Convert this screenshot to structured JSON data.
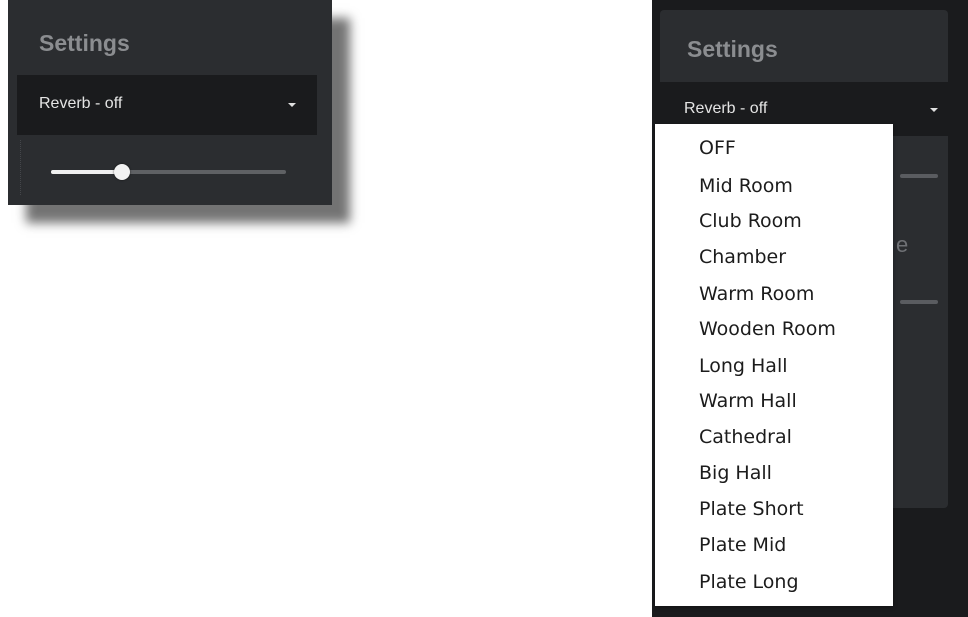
{
  "left_panel": {
    "title": "Settings",
    "dropdown": {
      "selected": "Reverb - off",
      "icon": "caret-down-icon"
    },
    "slider": {
      "value": 0.3
    }
  },
  "right_panel": {
    "title": "Settings",
    "dropdown": {
      "selected": "Reverb - off",
      "icon": "caret-down-icon"
    },
    "menu_items": [
      "OFF",
      "Mid Room",
      "Club Room",
      "Chamber",
      "Warm Room",
      "Wooden Room",
      "Long Hall",
      "Warm Hall",
      "Cathedral",
      "Big Hall",
      "Plate Short",
      "Plate Mid",
      "Plate Long"
    ]
  },
  "colors": {
    "panel": "#2b2d30",
    "dropdown": "#1a1b1d",
    "title_text": "#8b8d90",
    "menu_bg": "#ffffff"
  }
}
